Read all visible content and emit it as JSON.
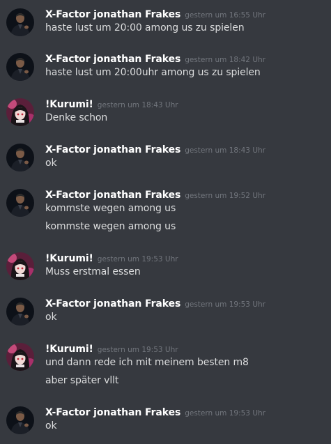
{
  "messages": [
    {
      "author": "X-Factor  jonathan Frakes",
      "avatar": "man-dark-avatar",
      "time": "gestern um 16:55 Uhr",
      "lines": [
        "haste lust um 20:00 among us zu spielen"
      ]
    },
    {
      "author": "X-Factor  jonathan Frakes",
      "avatar": "man-dark-avatar",
      "time": "gestern um 18:42 Uhr",
      "lines": [
        "haste lust um 20:00uhr among us zu spielen"
      ]
    },
    {
      "author": "!Kurumi!",
      "avatar": "anime-girl-avatar",
      "time": "gestern um 18:43 Uhr",
      "lines": [
        "Denke schon"
      ]
    },
    {
      "author": "X-Factor  jonathan Frakes",
      "avatar": "man-dark-avatar",
      "time": "gestern um 18:43 Uhr",
      "lines": [
        "ok"
      ]
    },
    {
      "author": "X-Factor  jonathan Frakes",
      "avatar": "man-dark-avatar",
      "time": "gestern um 19:52 Uhr",
      "lines": [
        "kommste wegen among us",
        "kommste wegen among us"
      ]
    },
    {
      "author": "!Kurumi!",
      "avatar": "anime-girl-avatar",
      "time": "gestern um 19:53 Uhr",
      "lines": [
        "Muss erstmal essen"
      ]
    },
    {
      "author": "X-Factor  jonathan Frakes",
      "avatar": "man-dark-avatar",
      "time": "gestern um 19:53 Uhr",
      "lines": [
        "ok"
      ]
    },
    {
      "author": "!Kurumi!",
      "avatar": "anime-girl-avatar",
      "time": "gestern um 19:53 Uhr",
      "lines": [
        "und dann rede ich mit meinem besten m8",
        "aber später vllt"
      ]
    },
    {
      "author": "X-Factor  jonathan Frakes",
      "avatar": "man-dark-avatar",
      "time": "gestern um 19:53 Uhr",
      "lines": [
        "ok"
      ]
    }
  ]
}
